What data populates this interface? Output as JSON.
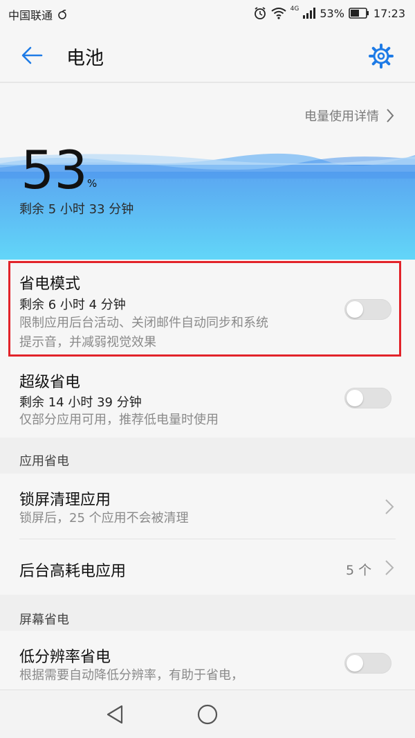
{
  "status_bar": {
    "carrier": "中国联通",
    "battery_percent_text": "53%",
    "network_text": "4G",
    "time": "17:23"
  },
  "app_bar": {
    "title": "电池",
    "icons": {
      "back": "back-arrow-icon",
      "settings": "gear-icon"
    },
    "accent_color": "#1E7BE6"
  },
  "battery": {
    "details_link": "电量使用详情",
    "level": "53",
    "unit": "%",
    "remaining": "剩余 5 小时 33 分钟"
  },
  "power_saving": {
    "title": "省电模式",
    "remaining": "剩余 6 小时 4 分钟",
    "description_line1": "限制应用后台活动、关闭邮件自动同步和系统",
    "description_line2": "提示音，并减弱视觉效果",
    "enabled": false
  },
  "ultra_saving": {
    "title": "超级省电",
    "remaining": "剩余 14 小时 39 分钟",
    "description": "仅部分应用可用，推荐低电量时使用",
    "enabled": false
  },
  "app_section": {
    "header": "应用省电",
    "lock_clean": {
      "title": "锁屏清理应用",
      "description": "锁屏后，25 个应用不会被清理"
    },
    "high_usage": {
      "title": "后台高耗电应用",
      "count": "5 个"
    }
  },
  "screen_section": {
    "header": "屏幕省电",
    "low_res": {
      "title": "低分辨率省电",
      "description": "根据需要自动降低分辨率，有助于省电，",
      "enabled": false
    }
  },
  "highlight_color": "#E2232A"
}
